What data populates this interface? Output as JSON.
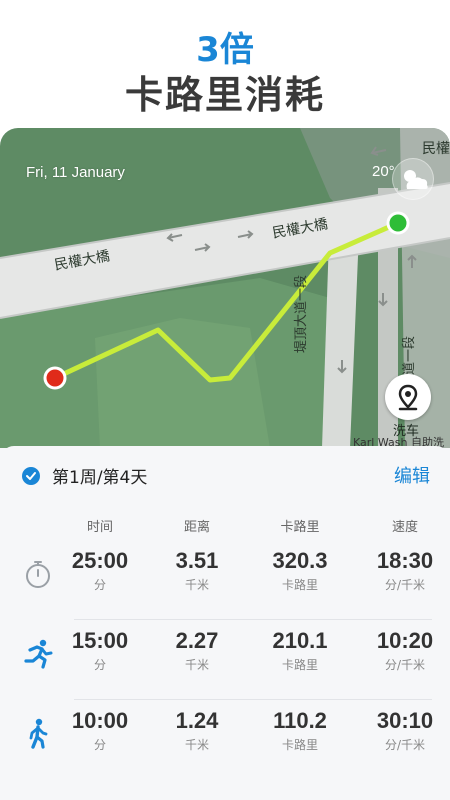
{
  "promo": {
    "accent": "3倍",
    "title": "卡路里消耗"
  },
  "map": {
    "date": "Fri, 11 January",
    "temperature": "20°",
    "road_label_left": "民權大橋",
    "road_label_right": "民權大橋",
    "road_label_corner": "民權",
    "street_label_1": "堤頂大道一段",
    "street_label_2": "大道一段",
    "poi_label": "洗车",
    "poi_partial": "Karl Wash 自助洗",
    "weather_icon": "partly-cloudy-icon",
    "location_icon": "map-pin-icon",
    "colors": {
      "route": "#c8ec3a",
      "start_marker": "#2ebd37",
      "end_marker": "#e02b1a"
    }
  },
  "summary": {
    "week_label": "第1周/第4天",
    "edit_label": "编辑",
    "columns": [
      "时间",
      "距离",
      "卡路里",
      "速度"
    ],
    "rows": [
      {
        "icon": "stopwatch-icon",
        "time": "25:00",
        "time_unit": "分",
        "distance": "3.51",
        "distance_unit": "千米",
        "calories": "320.3",
        "calories_unit": "卡路里",
        "speed": "18:30",
        "speed_unit": "分/千米"
      },
      {
        "icon": "running-icon",
        "time": "15:00",
        "time_unit": "分",
        "distance": "2.27",
        "distance_unit": "千米",
        "calories": "210.1",
        "calories_unit": "卡路里",
        "speed": "10:20",
        "speed_unit": "分/千米"
      },
      {
        "icon": "walking-icon",
        "time": "10:00",
        "time_unit": "分",
        "distance": "1.24",
        "distance_unit": "千米",
        "calories": "110.2",
        "calories_unit": "卡路里",
        "speed": "30:10",
        "speed_unit": "分/千米"
      }
    ]
  },
  "colors": {
    "accent": "#1a86d6"
  }
}
